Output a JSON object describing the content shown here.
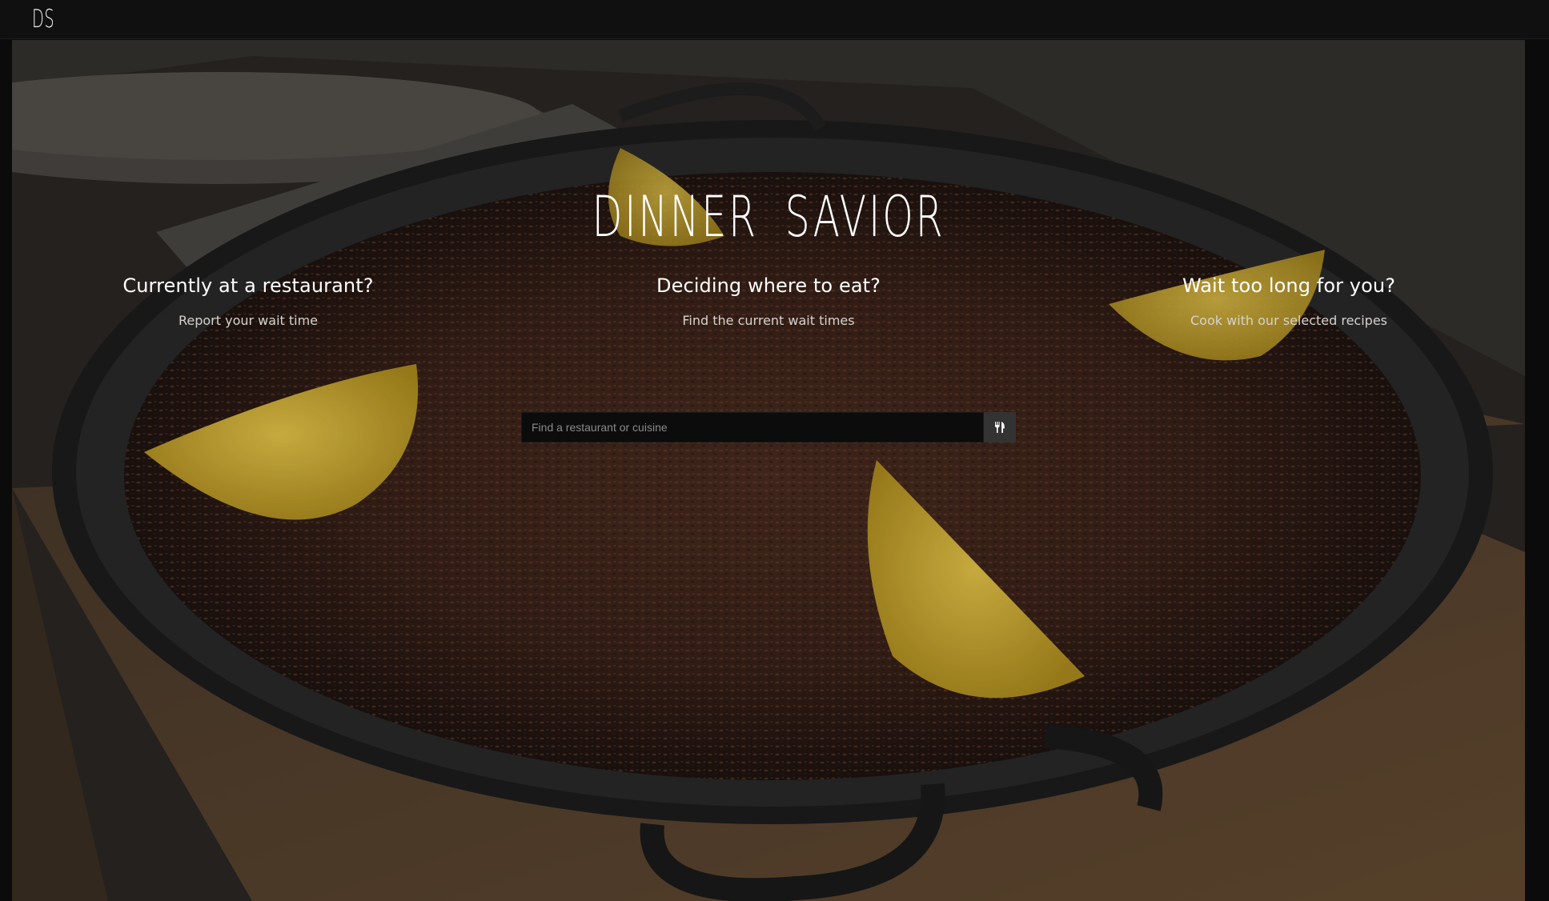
{
  "brand": {
    "logo_text": "DS"
  },
  "hero": {
    "title": "DINNER SAVIOR",
    "features": [
      {
        "heading": "Currently at a restaurant?",
        "subtext": "Report your wait time"
      },
      {
        "heading": "Deciding where to eat?",
        "subtext": "Find the current wait times"
      },
      {
        "heading": "Wait too long for you?",
        "subtext": "Cook with our selected recipes"
      }
    ]
  },
  "search": {
    "placeholder": "Find a restaurant or cuisine",
    "value": "",
    "button_icon": "fork-knife-icon"
  },
  "colors": {
    "navbar_bg": "#101010",
    "search_button_bg": "#333333",
    "text": "#ffffff"
  }
}
